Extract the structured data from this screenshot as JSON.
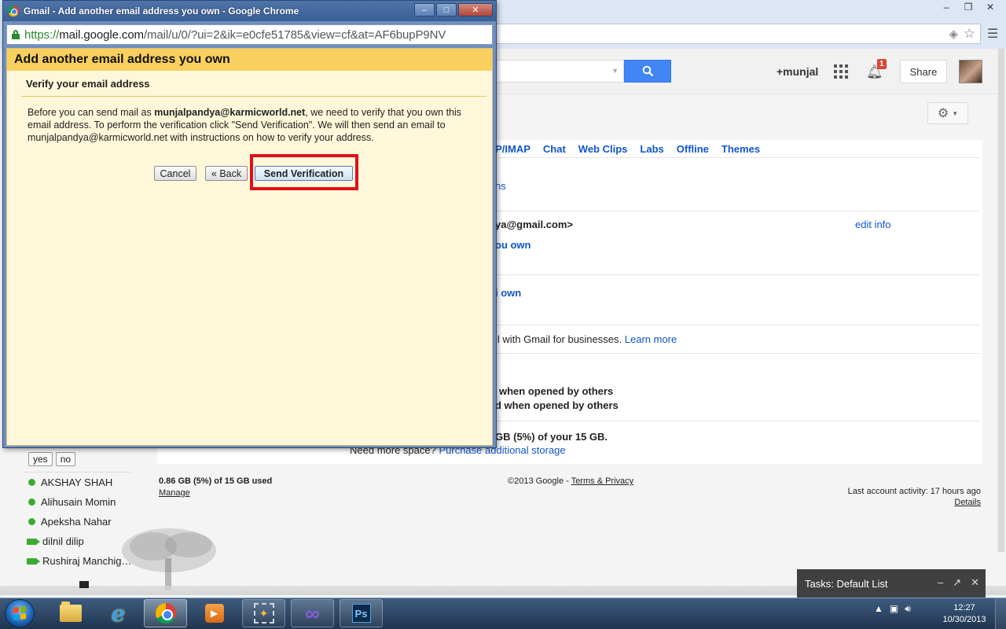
{
  "background_window": {
    "window_controls": [
      "–",
      "❐",
      "✕"
    ],
    "icons": [
      "gesture-icon",
      "star-icon",
      "menu-icon"
    ]
  },
  "gmail_header": {
    "user": "+munjal",
    "notification_count": "1",
    "share_label": "Share"
  },
  "settings": {
    "tabs": [
      "OP/IMAP",
      "Chat",
      "Web Clips",
      "Labs",
      "Offline",
      "Themes"
    ],
    "fragments": {
      "ns": "ns",
      "email_partial": "ya@gmail.com>",
      "edit_info": "edit info",
      "you_own_1": "ou own",
      "you_own_2": "i own",
      "businesses": "il with Gmail for businesses.",
      "learn_more": "Learn more",
      "opened_1": "when opened by others",
      "opened_2": "d when opened by others",
      "storage_partial": "GB (5%) of your 15 GB.",
      "need_space": "Need more space?",
      "purchase": "Purchase additional storage"
    }
  },
  "footer": {
    "usage": "0.86 GB (5%) of 15 GB used",
    "manage": "Manage",
    "copyright": "©2013 Google - ",
    "terms": "Terms & Privacy",
    "last_activity": "Last account activity: 17 hours ago",
    "details": "Details"
  },
  "chat": {
    "yes": "yes",
    "no": "no",
    "contacts": [
      {
        "name": "AKSHAY SHAH",
        "status": "online"
      },
      {
        "name": "Alihusain Momin",
        "status": "online"
      },
      {
        "name": "Apeksha Nahar",
        "status": "online"
      },
      {
        "name": "dilnil dilip",
        "status": "video"
      },
      {
        "name": "Rushiraj Manchig…",
        "status": "video"
      }
    ]
  },
  "tasks": {
    "label": "Tasks: Default List",
    "controls": [
      "–",
      "↗",
      "✕"
    ]
  },
  "popup": {
    "window_title": "Gmail - Add another email address you own - Google Chrome",
    "window_controls": [
      "–",
      "□",
      "✕"
    ],
    "url_scheme": "https://",
    "url_host": "mail.google.com",
    "url_path": "/mail/u/0/?ui=2&ik=e0cfe51785&view=cf&at=AF6bupP9NV",
    "header_title": "Add another email address you own",
    "section_title": "Verify your email address",
    "body_before": "Before you can send mail as ",
    "body_email": "munjalpandya@karmicworld.net",
    "body_after": ", we need to verify that you own this email address. To perform the verification click \"Send Verification\". We will then send an email to munjalpandya@karmicworld.net with instructions on how to verify your address.",
    "cancel_label": "Cancel",
    "back_label": "« Back",
    "send_label": "Send Verification",
    "highlight_color": "#e0101a"
  },
  "taskbar": {
    "apps": [
      "explorer",
      "internet-explorer",
      "chrome",
      "media-player",
      "tools",
      "infinity-app",
      "photoshop"
    ],
    "ps_label": "Ps",
    "time": "12:27",
    "date": "10/30/2013"
  }
}
